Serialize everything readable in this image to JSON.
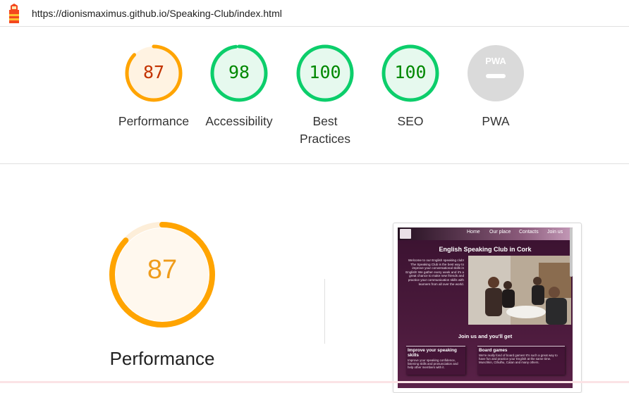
{
  "url": "https://dionismaximus.github.io/Speaking-Club/index.html",
  "colors": {
    "average": "#ffa400",
    "average_text": "#c33300",
    "pass": "#0cce6b",
    "pass_text": "#008800",
    "pwa": "#e0e0e0"
  },
  "gauges": [
    {
      "value": 87,
      "score": "87",
      "label": "Performance",
      "status": "average"
    },
    {
      "value": 98,
      "score": "98",
      "label": "Accessibility",
      "status": "pass"
    },
    {
      "value": 100,
      "score": "100",
      "label": "Best Practices",
      "status": "pass"
    },
    {
      "value": 100,
      "score": "100",
      "label": "SEO",
      "status": "pass"
    },
    {
      "value": null,
      "score": "PWA",
      "label": "PWA",
      "status": "pwa"
    }
  ],
  "main_gauge": {
    "value": 87,
    "score": "87",
    "label": "Performance"
  },
  "preview": {
    "nav": [
      "Home",
      "Our place",
      "Contacts",
      "Join us"
    ],
    "title": "English Speaking Club in Cork",
    "intro": "Welcome to our English speaking club! The Speaking Club is the best way to improve your conversational skills in English! We gather every week and it's a great chance to make new friends and practice your communication skills with learners from all over the world.",
    "join": "Join us and you'll get",
    "cards": [
      {
        "title": "Improve your speaking skills",
        "body": "Improve your speaking confidence, listening skills and pronunciation and help other members with it."
      },
      {
        "title": "Board games",
        "body": "We're really fond of board games! It's such a great way to have fun and practice your English at the same time. Munchkin, Cthulhu, Catan and many others."
      }
    ]
  }
}
